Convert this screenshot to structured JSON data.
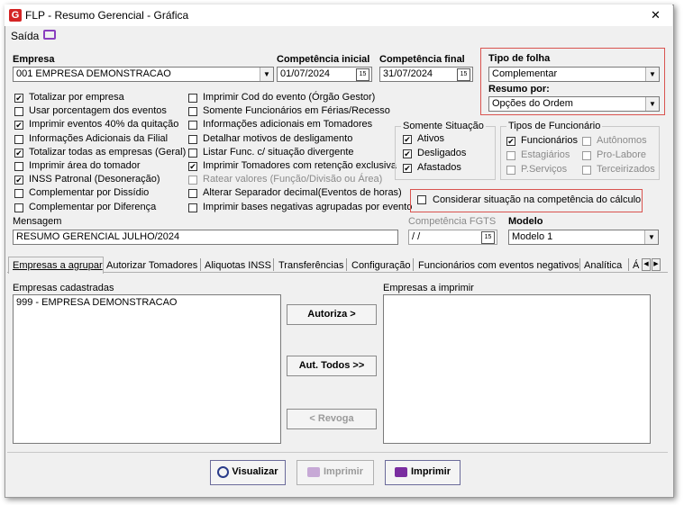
{
  "window": {
    "title": "FLP - Resumo Gerencial - Gráfica",
    "close": "✕"
  },
  "menu": {
    "saida": "Saída"
  },
  "header": {
    "empresa_label": "Empresa",
    "empresa_value": "001 EMPRESA DEMONSTRACAO",
    "comp_inicial_label": "Competência inicial",
    "comp_inicial_value": "01/07/2024",
    "comp_final_label": "Competência final",
    "comp_final_value": "31/07/2024",
    "tipo_folha_label": "Tipo de folha",
    "tipo_folha_value": "Complementar",
    "resumo_por_label": "Resumo por:",
    "resumo_por_value": "Opções do Ordem"
  },
  "options_col1": [
    {
      "label": "Totalizar por empresa",
      "checked": true
    },
    {
      "label": "Usar porcentagem dos eventos",
      "checked": false
    },
    {
      "label": "Imprimir eventos 40% da quitação",
      "checked": true
    },
    {
      "label": "Informações Adicionais da Filial",
      "checked": false
    },
    {
      "label": "Totalizar todas as empresas (Geral)",
      "checked": true
    },
    {
      "label": "Imprimir área do tomador",
      "checked": false
    },
    {
      "label": "INSS Patronal (Desoneração)",
      "checked": true
    },
    {
      "label": "Complementar por Dissídio",
      "checked": false
    },
    {
      "label": "Complementar por Diferença",
      "checked": false
    }
  ],
  "options_col2": [
    {
      "label": "Imprimir Cod do evento (Órgão Gestor)",
      "checked": false
    },
    {
      "label": "Somente Funcionários em Férias/Recesso",
      "checked": false
    },
    {
      "label": "Informações adicionais em Tomadores",
      "checked": false
    },
    {
      "label": "Detalhar motivos de desligamento",
      "checked": false
    },
    {
      "label": "Listar Func. c/ situação divergente",
      "checked": false
    },
    {
      "label": "Imprimir Tomadores com retenção exclusiva",
      "checked": true
    },
    {
      "label": "Ratear valores (Função/Divisão ou Área)",
      "checked": false
    },
    {
      "label": "Alterar Separador decimal(Eventos de horas)",
      "checked": false
    },
    {
      "label": "Imprimir bases negativas agrupadas por evento",
      "checked": false
    }
  ],
  "somente_situacao": {
    "title": "Somente Situação",
    "items": [
      {
        "label": "Ativos",
        "checked": true
      },
      {
        "label": "Desligados",
        "checked": true
      },
      {
        "label": "Afastados",
        "checked": true
      }
    ]
  },
  "tipos_funcionario": {
    "title": "Tipos de Funcionário",
    "items": [
      {
        "label": "Funcionários",
        "checked": true
      },
      {
        "label": "Autônomos",
        "checked": false
      },
      {
        "label": "Estagiários",
        "checked": false
      },
      {
        "label": "Pro-Labore",
        "checked": false
      },
      {
        "label": "P.Serviços",
        "checked": false
      },
      {
        "label": "Terceirizados",
        "checked": false
      }
    ]
  },
  "considerar": {
    "label": "Considerar situação na competência do cálculo",
    "checked": false
  },
  "mensagem": {
    "label": "Mensagem",
    "value": "RESUMO GERENCIAL JULHO/2024"
  },
  "fgts": {
    "label": "Competência FGTS",
    "value": " /  /"
  },
  "modelo": {
    "label": "Modelo",
    "value": "Modelo 1"
  },
  "tabs": [
    "Empresas a agrupar",
    "Autorizar Tomadores",
    "Aliquotas INSS",
    "Transferências",
    "Configuração",
    "Funcionários com eventos negativos",
    "Analítica",
    "Á"
  ],
  "panel": {
    "cadastradas_label": "Empresas cadastradas",
    "cadastradas_items": [
      "999 - EMPRESA DEMONSTRACAO"
    ],
    "imprimir_label": "Empresas a imprimir",
    "autoriza": "Autoriza >",
    "aut_todos": "Aut. Todos >>",
    "revoga": "< Revoga"
  },
  "footer": {
    "visualizar": "Visualizar",
    "imprimir_disabled": "Imprimir",
    "imprimir": "Imprimir"
  },
  "colors": {
    "accent_red": "#d9534f",
    "print_purple": "#7a2da0",
    "logo_red": "#d42424"
  }
}
